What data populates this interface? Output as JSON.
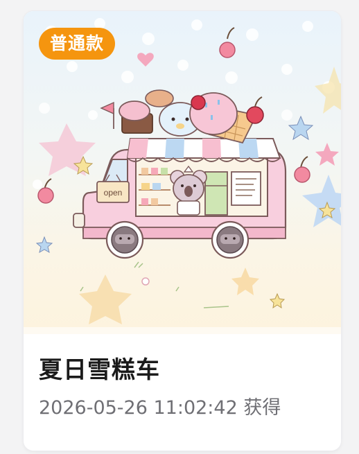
{
  "badge": {
    "label": "普通款"
  },
  "item": {
    "name": "夏日雪糕车",
    "obtained_time": "2026-05-26 11:02:42",
    "obtained_suffix": "获得"
  },
  "illustration": {
    "subject": "pastel ice cream truck with koala vendor",
    "sign_text": "open"
  },
  "colors": {
    "badge": "#f5950f",
    "title": "#1b1b1b",
    "meta": "#6f6f74",
    "card": "#ffffff"
  }
}
